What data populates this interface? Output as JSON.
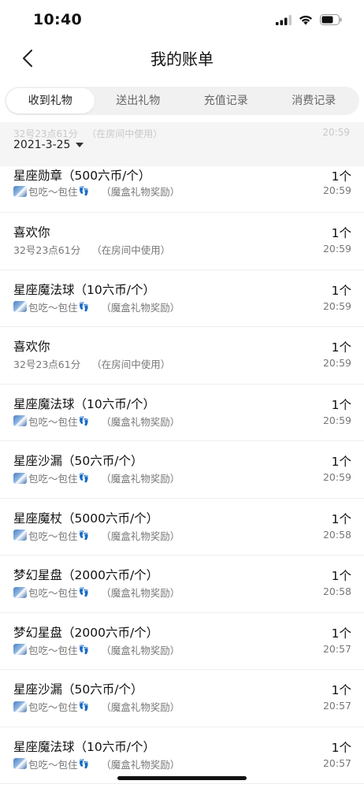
{
  "status_bar": {
    "time": "10:40"
  },
  "nav": {
    "title": "我的账单"
  },
  "tabs": [
    {
      "label": "收到礼物",
      "active": true
    },
    {
      "label": "送出礼物",
      "active": false
    },
    {
      "label": "充值记录",
      "active": false
    },
    {
      "label": "消费记录",
      "active": false
    }
  ],
  "date_header": {
    "ghost_user": "32号23点61分",
    "ghost_note": "（在房间中使用）",
    "ghost_time": "20:59",
    "date": "2021-3-25"
  },
  "records": [
    {
      "name": "星座勋章（500六币/个）",
      "user": "包吃～包住",
      "has_avatar": true,
      "note": "（魔盒礼物奖励）",
      "count": "1个",
      "time": "20:59"
    },
    {
      "name": "喜欢你",
      "user": "32号23点61分",
      "has_avatar": false,
      "note": "（在房间中使用）",
      "count": "1个",
      "time": "20:59"
    },
    {
      "name": "星座魔法球（10六币/个）",
      "user": "包吃～包住",
      "has_avatar": true,
      "note": "（魔盒礼物奖励）",
      "count": "1个",
      "time": "20:59"
    },
    {
      "name": "喜欢你",
      "user": "32号23点61分",
      "has_avatar": false,
      "note": "（在房间中使用）",
      "count": "1个",
      "time": "20:59"
    },
    {
      "name": "星座魔法球（10六币/个）",
      "user": "包吃～包住",
      "has_avatar": true,
      "note": "（魔盒礼物奖励）",
      "count": "1个",
      "time": "20:59"
    },
    {
      "name": "星座沙漏（50六币/个）",
      "user": "包吃～包住",
      "has_avatar": true,
      "note": "（魔盒礼物奖励）",
      "count": "1个",
      "time": "20:59"
    },
    {
      "name": "星座魔杖（5000六币/个）",
      "user": "包吃～包住",
      "has_avatar": true,
      "note": "（魔盒礼物奖励）",
      "count": "1个",
      "time": "20:58"
    },
    {
      "name": "梦幻星盘（2000六币/个）",
      "user": "包吃～包住",
      "has_avatar": true,
      "note": "（魔盒礼物奖励）",
      "count": "1个",
      "time": "20:58"
    },
    {
      "name": "梦幻星盘（2000六币/个）",
      "user": "包吃～包住",
      "has_avatar": true,
      "note": "（魔盒礼物奖励）",
      "count": "1个",
      "time": "20:57"
    },
    {
      "name": "星座沙漏（50六币/个）",
      "user": "包吃～包住",
      "has_avatar": true,
      "note": "（魔盒礼物奖励）",
      "count": "1个",
      "time": "20:57"
    },
    {
      "name": "星座魔法球（10六币/个）",
      "user": "包吃～包住",
      "has_avatar": true,
      "note": "（魔盒礼物奖励）",
      "count": "1个",
      "time": "20:57"
    }
  ]
}
